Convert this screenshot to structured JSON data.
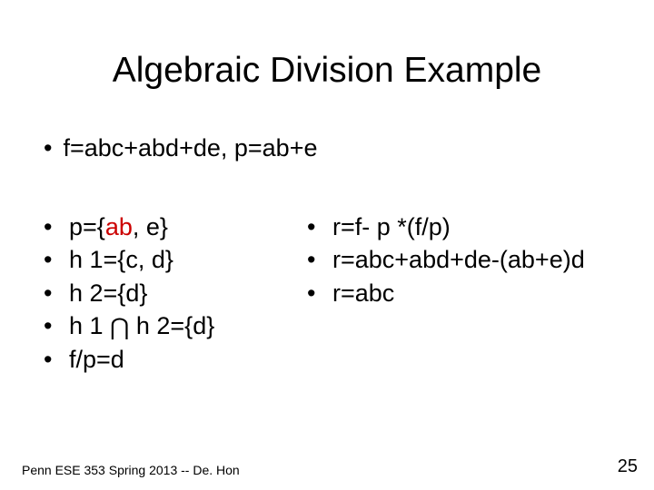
{
  "title": "Algebraic Division Example",
  "intro": "f=abc+abd+de, p=ab+e",
  "left": {
    "l1_pre": "p={",
    "l1_ab": "ab",
    "l1_post": ", e}",
    "l2": "h 1={c, d}",
    "l3": "h 2={d}",
    "l4_pre": "h 1 ",
    "l4_post": " h 2={d}",
    "l5": "f/p=d"
  },
  "right": {
    "r1": "r=f- p *(f/p)",
    "r2": "r=abc+abd+de-(ab+e)d",
    "r3": "r=abc"
  },
  "footer": "Penn ESE 353 Spring 2013 -- De. Hon",
  "pagenum": "25",
  "intersect_glyph": "⋂"
}
